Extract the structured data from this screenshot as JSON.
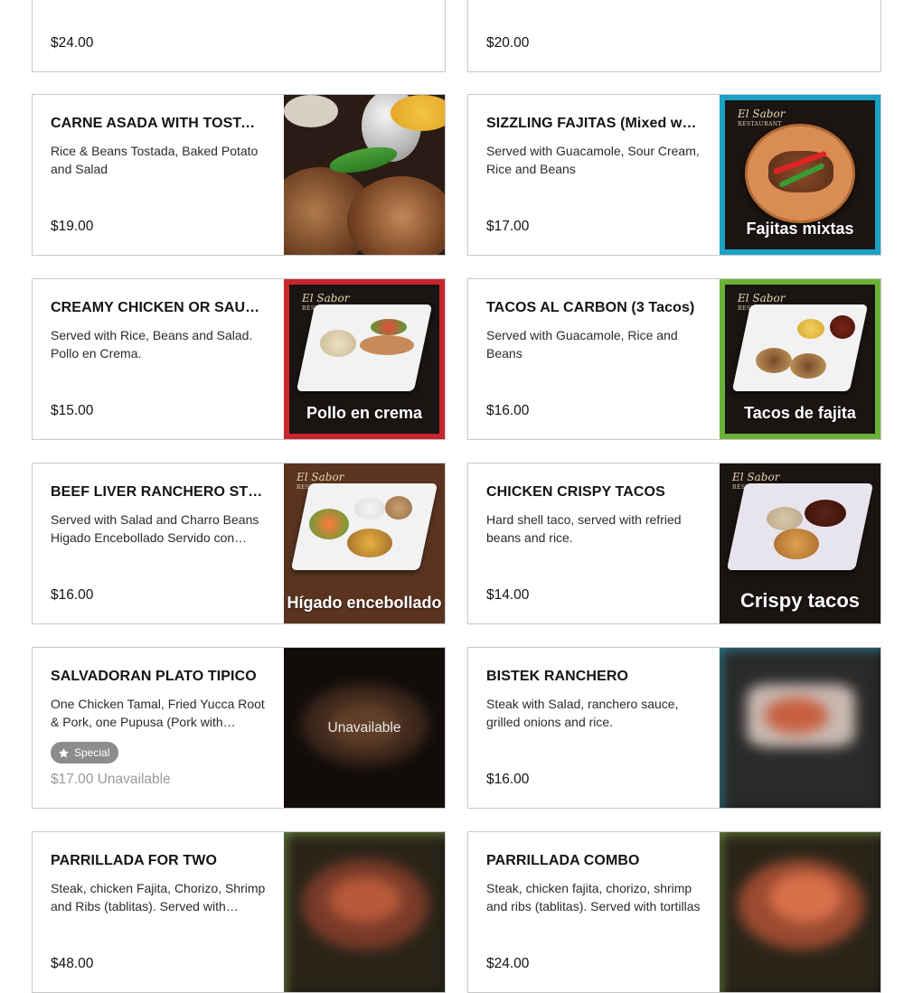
{
  "top_cards": [
    {
      "price": "$24.00"
    },
    {
      "price": "$20.00"
    }
  ],
  "items": [
    {
      "name": "CARNE ASADA WITH TOSTADA",
      "desc": "Rice & Beans Tostada, Baked Potato and Salad",
      "price": "$19.00",
      "image": "carne-asada-photo"
    },
    {
      "name": "SIZZLING FAJITAS (Mixed with Beef & Chicken)",
      "desc": "Served with Guacamole, Sour Cream, Rice and Beans",
      "price": "$17.00",
      "image_caption": "Fajitas mixtas",
      "logo": "El Sabor",
      "logo_sub": "RESTAURANT",
      "border": "#1ca0c4"
    },
    {
      "name": "CREAMY CHICKEN OR SAUSAGE",
      "desc": "Served with Rice, Beans and Salad. Pollo en Crema.",
      "price": "$15.00",
      "image_caption": "Pollo en crema",
      "logo": "El Sabor",
      "logo_sub": "RESTAURANT",
      "border": "#c8262e"
    },
    {
      "name": "TACOS AL CARBON (3 Tacos)",
      "desc": "Served with Guacamole, Rice and Beans",
      "price": "$16.00",
      "image_caption": "Tacos de fajita",
      "logo": "El Sabor",
      "logo_sub": "RESTAURANT",
      "border": "#6bb23a"
    },
    {
      "name": "BEEF LIVER RANCHERO STYLE",
      "desc": "Served with Salad and Charro Beans Higado Encebollado Servido con Ensalada y Frijoles Charros",
      "price": "$16.00",
      "image_caption": "Hígado encebollado",
      "logo": "El Sabor",
      "logo_sub": "RESTAURANT",
      "border": "#e0702a"
    },
    {
      "name": "CHICKEN CRISPY TACOS",
      "desc": "Hard shell taco, served with refried beans and rice.",
      "price": "$14.00",
      "image_caption": "Crispy tacos",
      "logo": "El Sabor",
      "logo_sub": "RESTAURANT",
      "border": "#1a1a1a"
    },
    {
      "name": "SALVADORAN PLATO TIPICO",
      "desc": "One Chicken Tamal, Fried Yucca Root & Pork, one Pupusa (Pork with cheese)",
      "price": "$17.00 Unavailable",
      "badge": "Special",
      "overlay": "Unavailable"
    },
    {
      "name": "BISTEK RANCHERO",
      "desc": "Steak with Salad, ranchero sauce, grilled onions and rice.",
      "price": "$16.00"
    },
    {
      "name": "PARRILLADA FOR TWO",
      "desc": "Steak, chicken Fajita, Chorizo, Shrimp and Ribs (tablitas). Served with tortillas",
      "price": "$48.00"
    },
    {
      "name": "PARRILLADA COMBO",
      "desc": "Steak, chicken fajita, chorizo, shrimp and ribs (tablitas). Served with tortillas",
      "price": "$24.00"
    }
  ]
}
